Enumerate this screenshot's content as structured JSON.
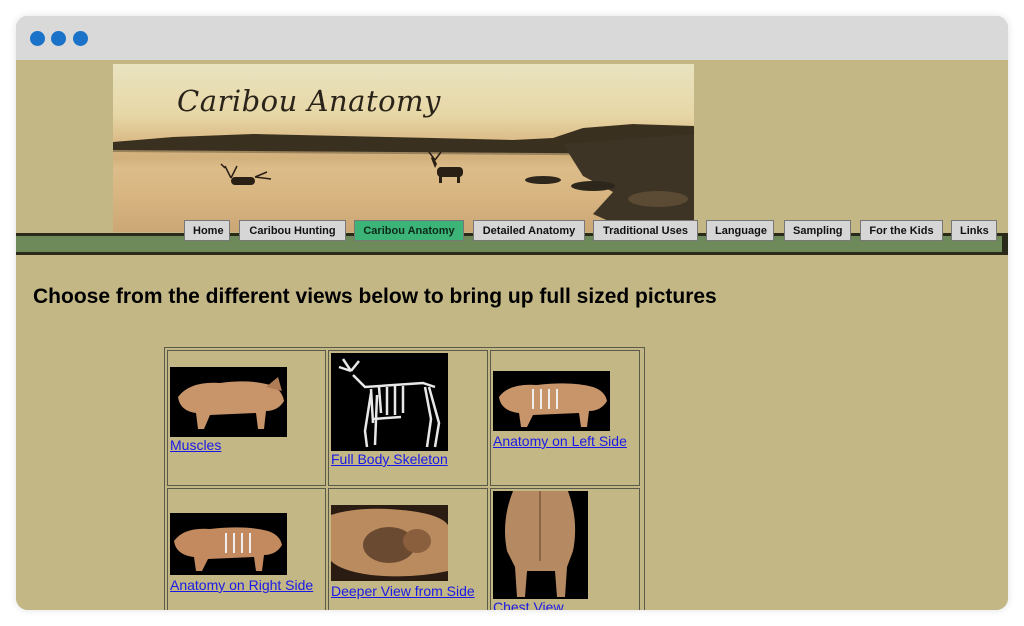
{
  "window": {
    "dots": [
      "blue-dot-1",
      "blue-dot-2",
      "blue-dot-3"
    ]
  },
  "banner": {
    "title": "Caribou Anatomy"
  },
  "nav": {
    "items": [
      {
        "label": "Home"
      },
      {
        "label": "Caribou Hunting"
      },
      {
        "label": "Caribou Anatomy",
        "active": true
      },
      {
        "label": "Detailed Anatomy"
      },
      {
        "label": "Traditional Uses"
      },
      {
        "label": "Language"
      },
      {
        "label": "Sampling"
      },
      {
        "label": "For the Kids"
      },
      {
        "label": "Links"
      }
    ]
  },
  "main": {
    "heading": "Choose from the different views below to bring up full sized pictures",
    "views": [
      {
        "label": "Muscles"
      },
      {
        "label": "Full Body Skeleton"
      },
      {
        "label": "Anatomy on Left Side"
      },
      {
        "label": "Anatomy on Right Side"
      },
      {
        "label": "Deeper View from Side"
      },
      {
        "label": "Chest View"
      }
    ]
  },
  "colors": {
    "page_bg": "#c3b786",
    "nav_active": "#3cb478",
    "nav_bar": "#6e8a5a",
    "link": "#1a1ae6"
  }
}
